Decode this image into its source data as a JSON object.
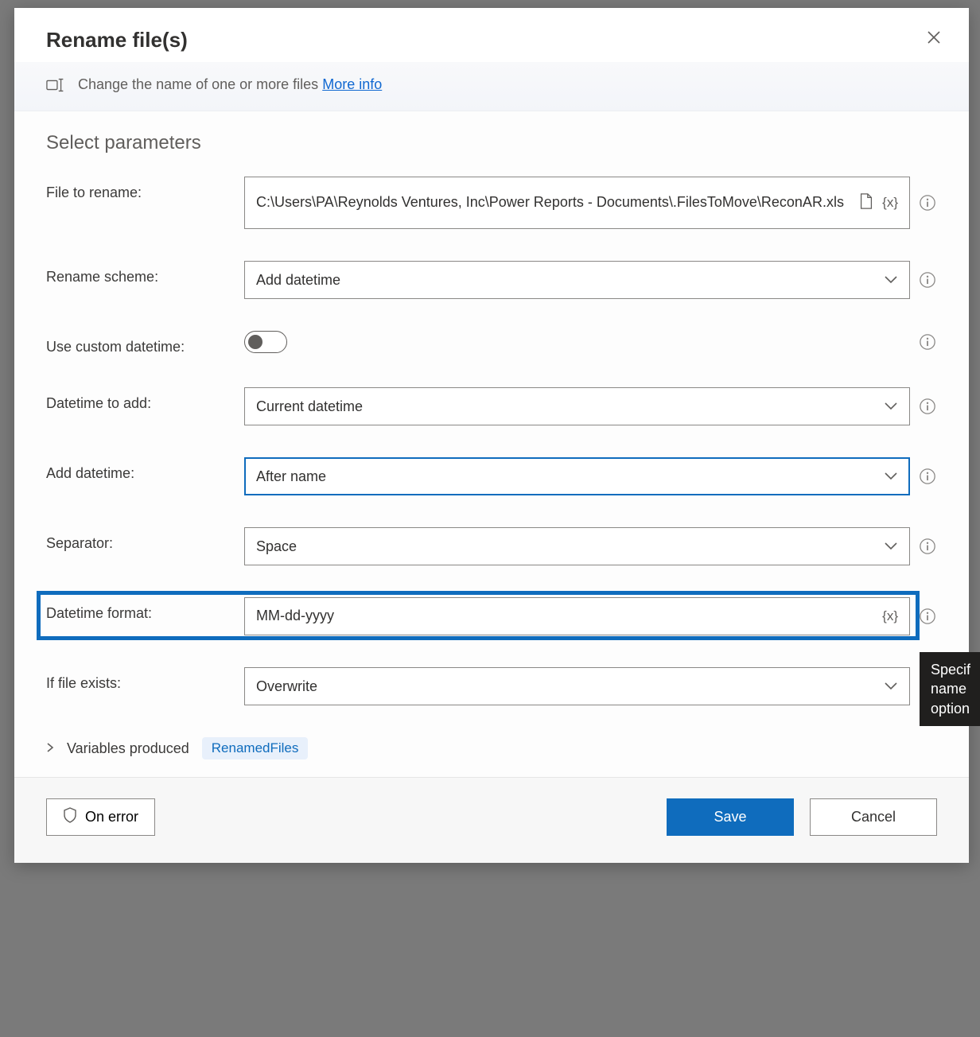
{
  "dialog": {
    "title": "Rename file(s)",
    "description": "Change the name of one or more files",
    "more_info": "More info"
  },
  "section": {
    "title": "Select parameters"
  },
  "fields": {
    "file_to_rename": {
      "label": "File to rename:",
      "value": "C:\\Users\\PA\\Reynolds Ventures, Inc\\Power Reports - Documents\\.FilesToMove\\ReconAR.xls",
      "var_token": "{x}"
    },
    "rename_scheme": {
      "label": "Rename scheme:",
      "value": "Add datetime"
    },
    "custom_dt": {
      "label": "Use custom datetime:"
    },
    "dt_to_add": {
      "label": "Datetime to add:",
      "value": "Current datetime"
    },
    "add_dt": {
      "label": "Add datetime:",
      "value": "After name"
    },
    "separator": {
      "label": "Separator:",
      "value": "Space"
    },
    "dt_format": {
      "label": "Datetime format:",
      "value": "MM-dd-yyyy",
      "var_token": "{x}"
    },
    "if_exists": {
      "label": "If file exists:",
      "value": "Overwrite"
    }
  },
  "vars": {
    "label": "Variables produced",
    "chip": "RenamedFiles"
  },
  "footer": {
    "on_error": "On error",
    "save": "Save",
    "cancel": "Cancel"
  },
  "tooltip": {
    "line1": "Specif",
    "line2": "name",
    "line3": "option"
  }
}
